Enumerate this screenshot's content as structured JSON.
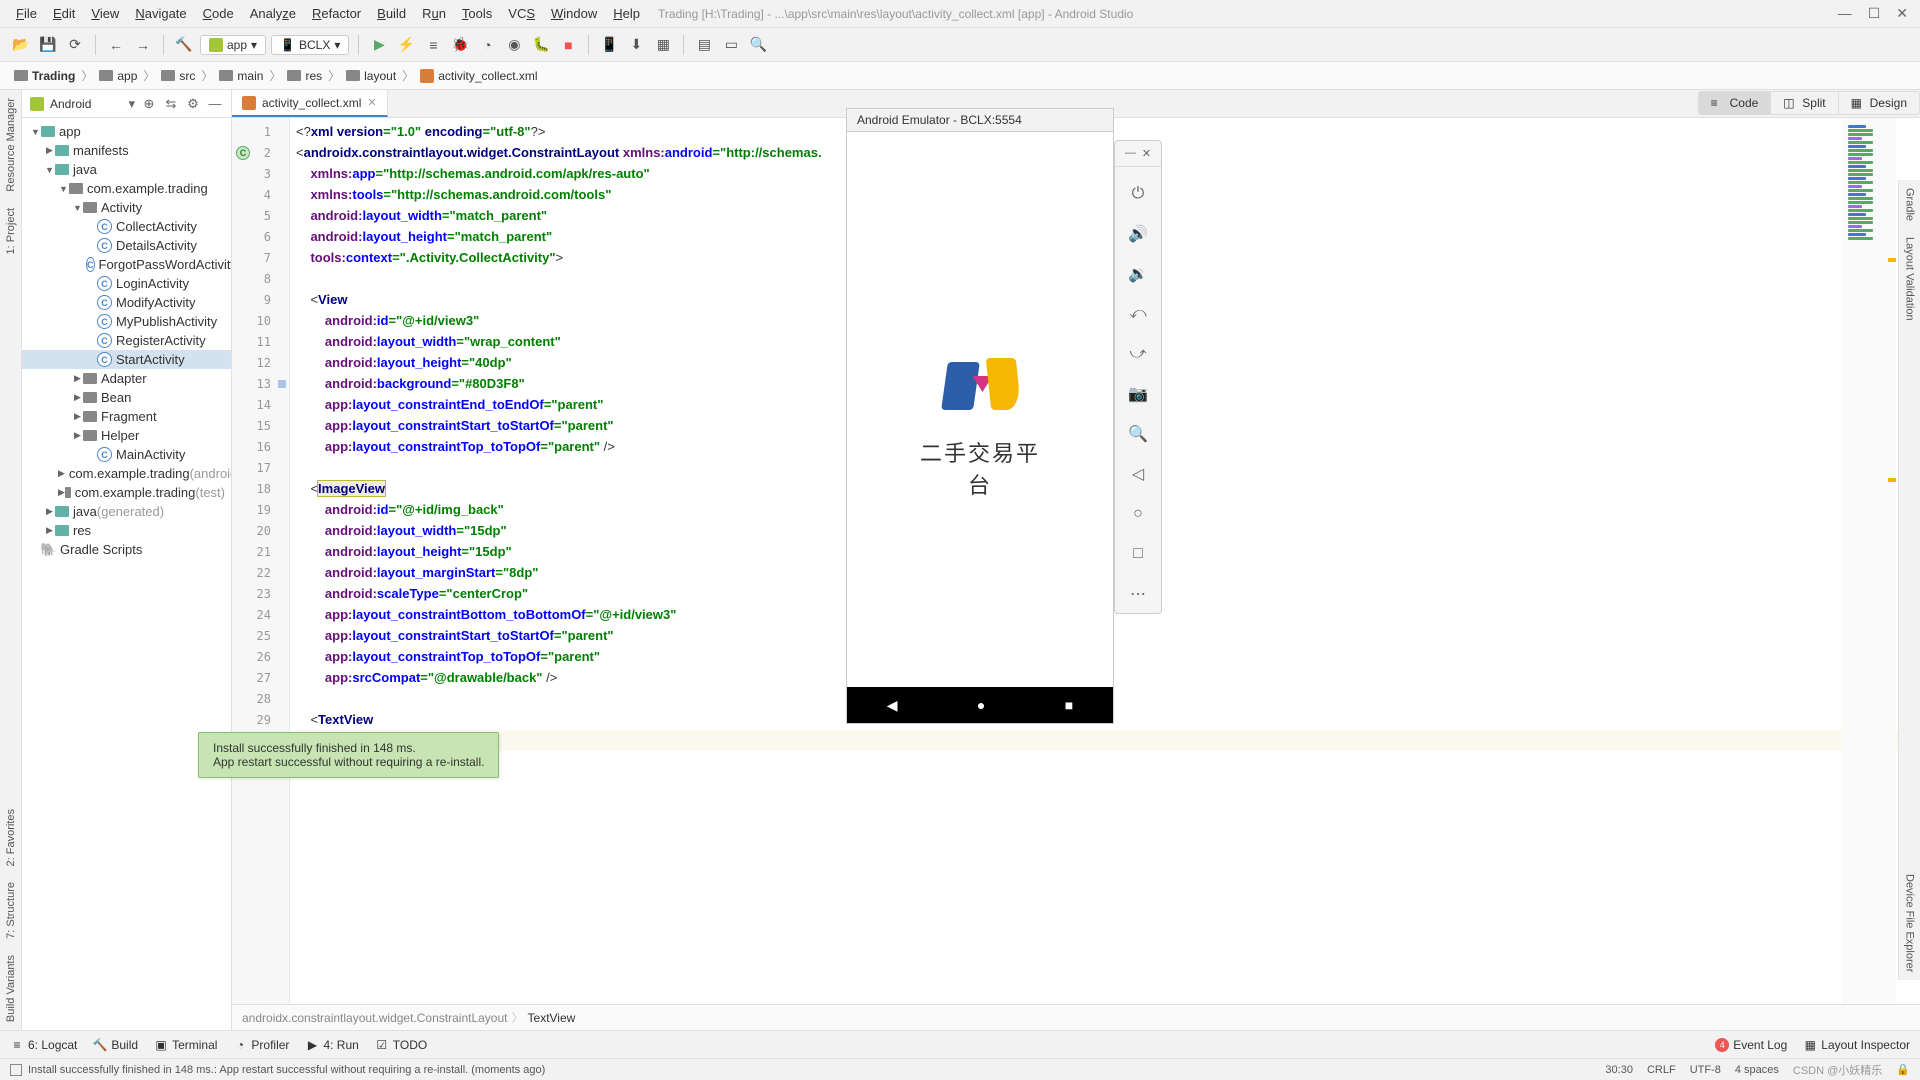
{
  "menubar": {
    "items": [
      "File",
      "Edit",
      "View",
      "Navigate",
      "Code",
      "Analyze",
      "Refactor",
      "Build",
      "Run",
      "Tools",
      "VCS",
      "Window",
      "Help"
    ],
    "title": "Trading [H:\\Trading] - ...\\app\\src\\main\\res\\layout\\activity_collect.xml [app] - Android Studio"
  },
  "toolbar": {
    "app_label": "app",
    "device_label": "BCLX"
  },
  "breadcrumb": {
    "items": [
      "Trading",
      "app",
      "src",
      "main",
      "res",
      "layout",
      "activity_collect.xml"
    ]
  },
  "left_strips": {
    "resource": "Resource Manager",
    "project": "1: Project",
    "favorites": "2: Favorites",
    "structure": "7: Structure",
    "variants": "Build Variants"
  },
  "right_strips": {
    "gradle": "Gradle",
    "layout": "Layout Validation",
    "device": "Device File Explorer"
  },
  "project": {
    "header": "Android",
    "tree": [
      {
        "d": 0,
        "arrow": "▼",
        "icon": "folder-teal",
        "label": "app",
        "bold": true
      },
      {
        "d": 1,
        "arrow": "▶",
        "icon": "folder-teal",
        "label": "manifests"
      },
      {
        "d": 1,
        "arrow": "▼",
        "icon": "folder-teal",
        "label": "java"
      },
      {
        "d": 2,
        "arrow": "▼",
        "icon": "folder",
        "label": "com.example.trading"
      },
      {
        "d": 3,
        "arrow": "▼",
        "icon": "folder",
        "label": "Activity"
      },
      {
        "d": 4,
        "icon": "class",
        "label": "CollectActivity"
      },
      {
        "d": 4,
        "icon": "class",
        "label": "DetailsActivity"
      },
      {
        "d": 4,
        "icon": "class",
        "label": "ForgotPassWordActivity"
      },
      {
        "d": 4,
        "icon": "class",
        "label": "LoginActivity"
      },
      {
        "d": 4,
        "icon": "class",
        "label": "ModifyActivity"
      },
      {
        "d": 4,
        "icon": "class",
        "label": "MyPublishActivity"
      },
      {
        "d": 4,
        "icon": "class",
        "label": "RegisterActivity"
      },
      {
        "d": 4,
        "icon": "class",
        "label": "StartActivity",
        "selected": true
      },
      {
        "d": 3,
        "arrow": "▶",
        "icon": "folder",
        "label": "Adapter"
      },
      {
        "d": 3,
        "arrow": "▶",
        "icon": "folder",
        "label": "Bean"
      },
      {
        "d": 3,
        "arrow": "▶",
        "icon": "folder",
        "label": "Fragment"
      },
      {
        "d": 3,
        "arrow": "▶",
        "icon": "folder",
        "label": "Helper"
      },
      {
        "d": 4,
        "icon": "class",
        "label": "MainActivity"
      },
      {
        "d": 2,
        "arrow": "▶",
        "icon": "folder",
        "label": "com.example.trading",
        "suffix": " (androidTest)",
        "muted": true
      },
      {
        "d": 2,
        "arrow": "▶",
        "icon": "folder",
        "label": "com.example.trading",
        "suffix": " (test)",
        "muted": true
      },
      {
        "d": 1,
        "arrow": "▶",
        "icon": "folder-teal",
        "label": "java",
        "suffix": " (generated)",
        "muted": true
      },
      {
        "d": 1,
        "arrow": "▶",
        "icon": "folder-teal",
        "label": "res"
      },
      {
        "d": 0,
        "icon": "gradle",
        "label": "Gradle Scripts"
      }
    ]
  },
  "editor": {
    "tab_name": "activity_collect.xml",
    "view_modes": {
      "code": "Code",
      "split": "Split",
      "design": "Design"
    },
    "breadcrumb_bottom": [
      "androidx.constraintlayout.widget.ConstraintLayout",
      "TextView"
    ],
    "lines_count": 29
  },
  "emulator": {
    "title": "Android Emulator - BCLX:5554",
    "logo_text": "二手交易平台"
  },
  "toast": {
    "line1": "Install successfully finished in 148 ms.",
    "line2": "App restart successful without requiring a re-install."
  },
  "bottom_tools": {
    "logcat": "6: Logcat",
    "build": "Build",
    "terminal": "Terminal",
    "profiler": "Profiler",
    "run": "4: Run",
    "todo": "TODO",
    "event_log": "Event Log",
    "layout_inspector": "Layout Inspector"
  },
  "statusbar": {
    "message": "Install successfully finished in 148 ms.: App restart successful without requiring a re-install. (moments ago)",
    "position": "30:30",
    "line_sep": "CRLF",
    "encoding": "UTF-8",
    "indent": "4 spaces"
  }
}
